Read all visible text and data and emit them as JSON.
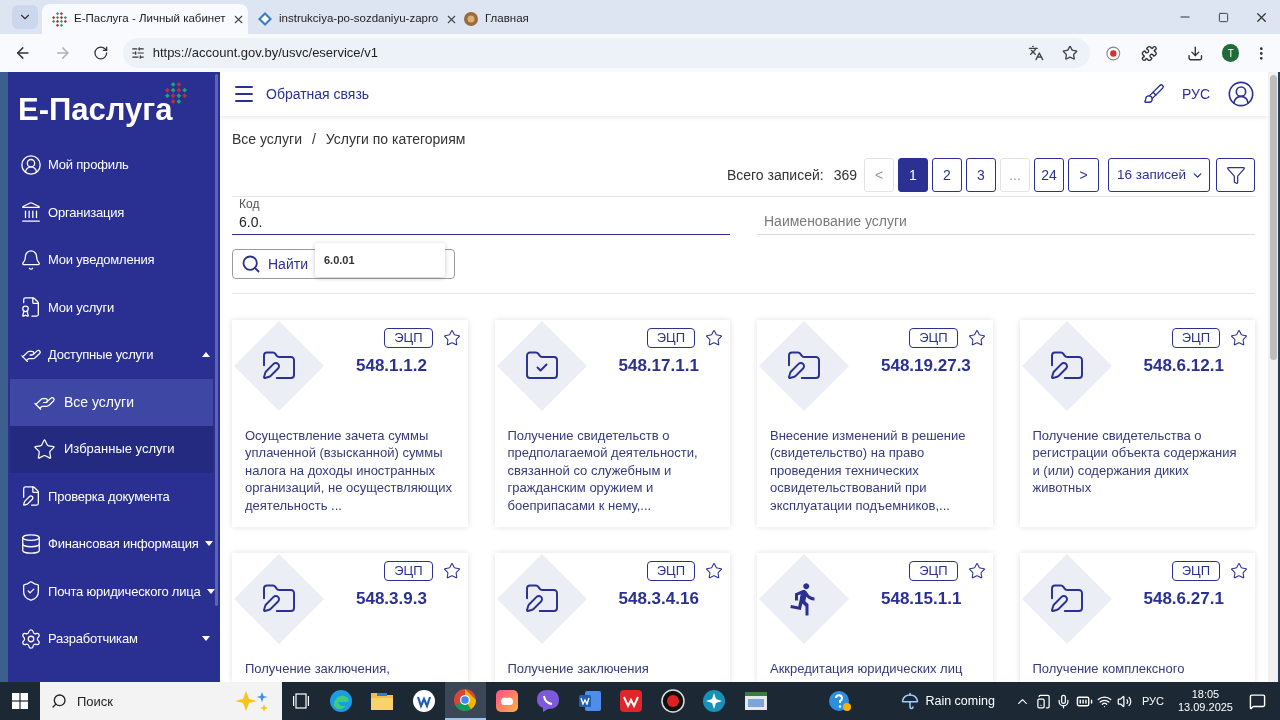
{
  "browser": {
    "tabs": [
      {
        "title": "Е-Паслуга - Личный кабинет",
        "selected": true
      },
      {
        "title": "instrukciya-po-sozdaniyu-zapro",
        "selected": false
      },
      {
        "title": "Главная",
        "selected": false
      }
    ],
    "url": "https://account.gov.by/usvc/eservice/v1",
    "profile_initial": "T"
  },
  "sidebar": {
    "logo": "Е-Паслуга",
    "items": [
      {
        "label": "Мой профиль",
        "kind": "link",
        "selected": false
      },
      {
        "label": "Организация",
        "kind": "link",
        "selected": false
      },
      {
        "label": "Мои уведомления",
        "kind": "link",
        "selected": false
      },
      {
        "label": "Мои услуги",
        "kind": "link",
        "selected": false
      },
      {
        "label": "Доступные услуги",
        "kind": "group",
        "selected": false,
        "expanded": true,
        "children": [
          {
            "label": "Все услуги",
            "selected": true
          },
          {
            "label": "Избранные услуги",
            "selected": false
          }
        ]
      },
      {
        "label": "Проверка документа",
        "kind": "link",
        "selected": false
      },
      {
        "label": "Финансовая информация",
        "kind": "group",
        "selected": false,
        "expanded": false
      },
      {
        "label": "Почта юридического лица",
        "kind": "group",
        "selected": false,
        "expanded": false
      },
      {
        "label": "Разработчикам",
        "kind": "group",
        "selected": false,
        "expanded": false
      }
    ]
  },
  "header": {
    "feedback": "Обратная связь",
    "language": "РУС"
  },
  "breadcrumbs": {
    "items": [
      "Все услуги",
      "Услуги по категориям"
    ],
    "separator": "/"
  },
  "pagination": {
    "total_label": "Всего записей:",
    "total": "369",
    "prev": {
      "label": "<",
      "disabled": true
    },
    "pages": [
      {
        "label": "1",
        "selected": true,
        "disabled": false
      },
      {
        "label": "2",
        "selected": false,
        "disabled": false
      },
      {
        "label": "3",
        "selected": false,
        "disabled": false
      },
      {
        "label": "...",
        "selected": false,
        "disabled": true
      },
      {
        "label": "24",
        "selected": false,
        "disabled": false
      }
    ],
    "next": {
      "label": ">",
      "disabled": false
    },
    "page_size": "16 записей"
  },
  "filters": {
    "code_field": {
      "label": "Код",
      "value": "6.0."
    },
    "name_field": {
      "placeholder": "Наименование услуги"
    },
    "suggestions": [
      "6.0.01"
    ],
    "search_button": "Найти"
  },
  "cards": [
    {
      "badge": "ЭЦП",
      "favorite": false,
      "code": "548.1.1.2",
      "description": "Осуществление зачета суммы уплаченной (взысканной) суммы налога на доходы иностранных организаций, не осуществляющих деятельность ..."
    },
    {
      "badge": "ЭЦП",
      "favorite": false,
      "code": "548.17.1.1",
      "description": "Получение свидетельств о предполагаемой деятельности, связанной со служебным и гражданским оружием и боеприпасами к нему,..."
    },
    {
      "badge": "ЭЦП",
      "favorite": false,
      "code": "548.19.27.3",
      "description": "Внесение изменений в решение (свидетельство) на право проведения технических освидетельствований при эксплуатации подъемников,..."
    },
    {
      "badge": "ЭЦП",
      "favorite": false,
      "code": "548.6.12.1",
      "description": "Получение свидетельства о регистрации объекта содержания и (или) содержания диких животных"
    },
    {
      "badge": "ЭЦП",
      "favorite": false,
      "code": "548.3.9.3",
      "description": "Получение заключения,"
    },
    {
      "badge": "ЭЦП",
      "favorite": false,
      "code": "548.3.4.16",
      "description": "Получение заключения"
    },
    {
      "badge": "ЭЦП",
      "favorite": false,
      "code": "548.15.1.1",
      "description": "Аккредитация юридических лиц"
    },
    {
      "badge": "ЭЦП",
      "favorite": false,
      "code": "548.6.27.1",
      "description": "Получение комплексного"
    }
  ],
  "taskbar": {
    "search_placeholder": "Поиск",
    "apps": [
      {
        "selected": false
      },
      {
        "selected": false
      },
      {
        "selected": false
      },
      {
        "selected": true
      },
      {
        "selected": false
      },
      {
        "selected": false
      },
      {
        "selected": false
      },
      {
        "selected": false
      },
      {
        "selected": false
      },
      {
        "selected": false
      },
      {
        "selected": false
      },
      {
        "selected": false
      }
    ],
    "weather": "Rain coming",
    "language": "РУС",
    "time": "18:05",
    "date": "13.09.2025"
  }
}
